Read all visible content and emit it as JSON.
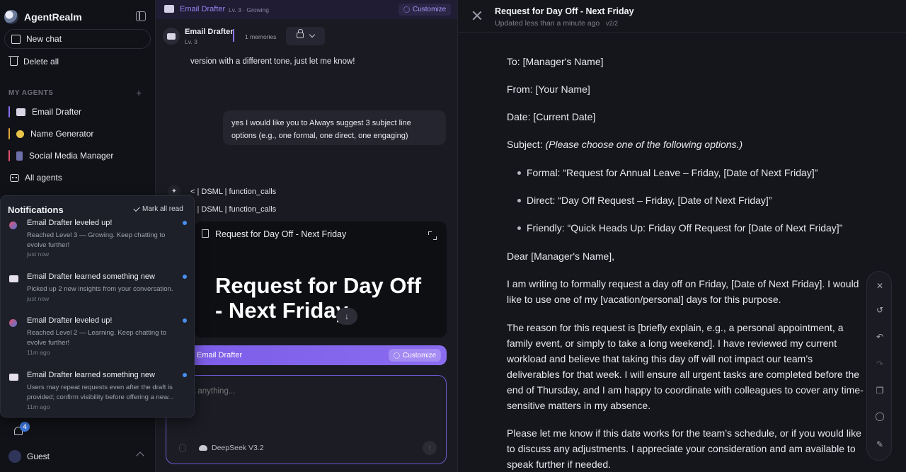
{
  "app": {
    "name": "AgentRealm"
  },
  "sidebar": {
    "new_chat": "New chat",
    "delete_all": "Delete all",
    "section_label": "MY AGENTS",
    "agents": [
      {
        "label": "Email Drafter",
        "color": "#8a70f0"
      },
      {
        "label": "Name Generator",
        "color": "#e0a63a"
      },
      {
        "label": "Social Media Manager",
        "color": "#e0506a"
      }
    ],
    "all_agents": "All agents",
    "notification_count": "4",
    "user": "Guest"
  },
  "notifications": {
    "title": "Notifications",
    "mark_all_read": "Mark all read",
    "items": [
      {
        "title": "Email Drafter leveled up!",
        "body": "Reached Level 3 — Growing. Keep chatting to evolve further!",
        "time": "just now"
      },
      {
        "title": "Email Drafter learned something new",
        "body": "Picked up 2 new insights from your conversation.",
        "time": "just now"
      },
      {
        "title": "Email Drafter leveled up!",
        "body": "Reached Level 2 — Learning. Keep chatting to evolve further!",
        "time": "11m ago"
      },
      {
        "title": "Email Drafter learned something new",
        "body": "Users may repeat requests even after the draft is provided; confirm visibility before offering a new...",
        "time": "11m ago"
      }
    ]
  },
  "chat": {
    "topbar": {
      "agent": "Email Drafter",
      "level": "Lv. 3 · Growing",
      "customize": "Customize"
    },
    "header": {
      "agent": "Email Drafter",
      "level": "Lv. 3",
      "memories": "1 memories"
    },
    "assistant_tail": "version with a different tone, just let me know!",
    "user_message": "yes I would like you to Always suggest 3 subject line options (e.g., one formal, one direct, one engaging)",
    "dsml_lines": [
      "< | DSML | function_calls",
      "< | DSML | function_calls"
    ],
    "doc_card": {
      "title": "Request for Day Off - Next Friday",
      "preview": "Request for Day Off - Next Friday"
    },
    "agent_strip": {
      "name": "Email Drafter",
      "customize": "Customize"
    },
    "composer": {
      "placeholder": "Ask anything...",
      "model": "DeepSeek V3.2"
    }
  },
  "document": {
    "title": "Request for Day Off - Next Friday",
    "updated": "Updated less than a minute ago",
    "version": "v2/2",
    "to": "To: [Manager's Name]",
    "from": "From: [Your Name]",
    "date": "Date: [Current Date]",
    "subject_label": "Subject: ",
    "subject_note": "(Please choose one of the following options.)",
    "options": [
      "Formal: “Request for Annual Leave – Friday, [Date of Next Friday]”",
      "Direct: “Day Off Request – Friday, [Date of Next Friday]”",
      "Friendly: “Quick Heads Up: Friday Off Request for [Date of Next Friday]”"
    ],
    "greeting": "Dear [Manager's Name],",
    "para1": "I am writing to formally request a day off on Friday, [Date of Next Friday]. I would like to use one of my [vacation/personal] days for this purpose.",
    "para2": "The reason for this request is [briefly explain, e.g., a personal appointment, a family event, or simply to take a long weekend]. I have reviewed my current workload and believe that taking this day off will not impact our team’s deliverables for that week. I will ensure all urgent tasks are completed before the end of Thursday, and I am happy to coordinate with colleagues to cover any time-sensitive matters in my absence.",
    "para3": "Please let me know if this date works for the team’s schedule, or if you would like to discuss any adjustments. I appreciate your consideration and am available to speak further if needed."
  }
}
